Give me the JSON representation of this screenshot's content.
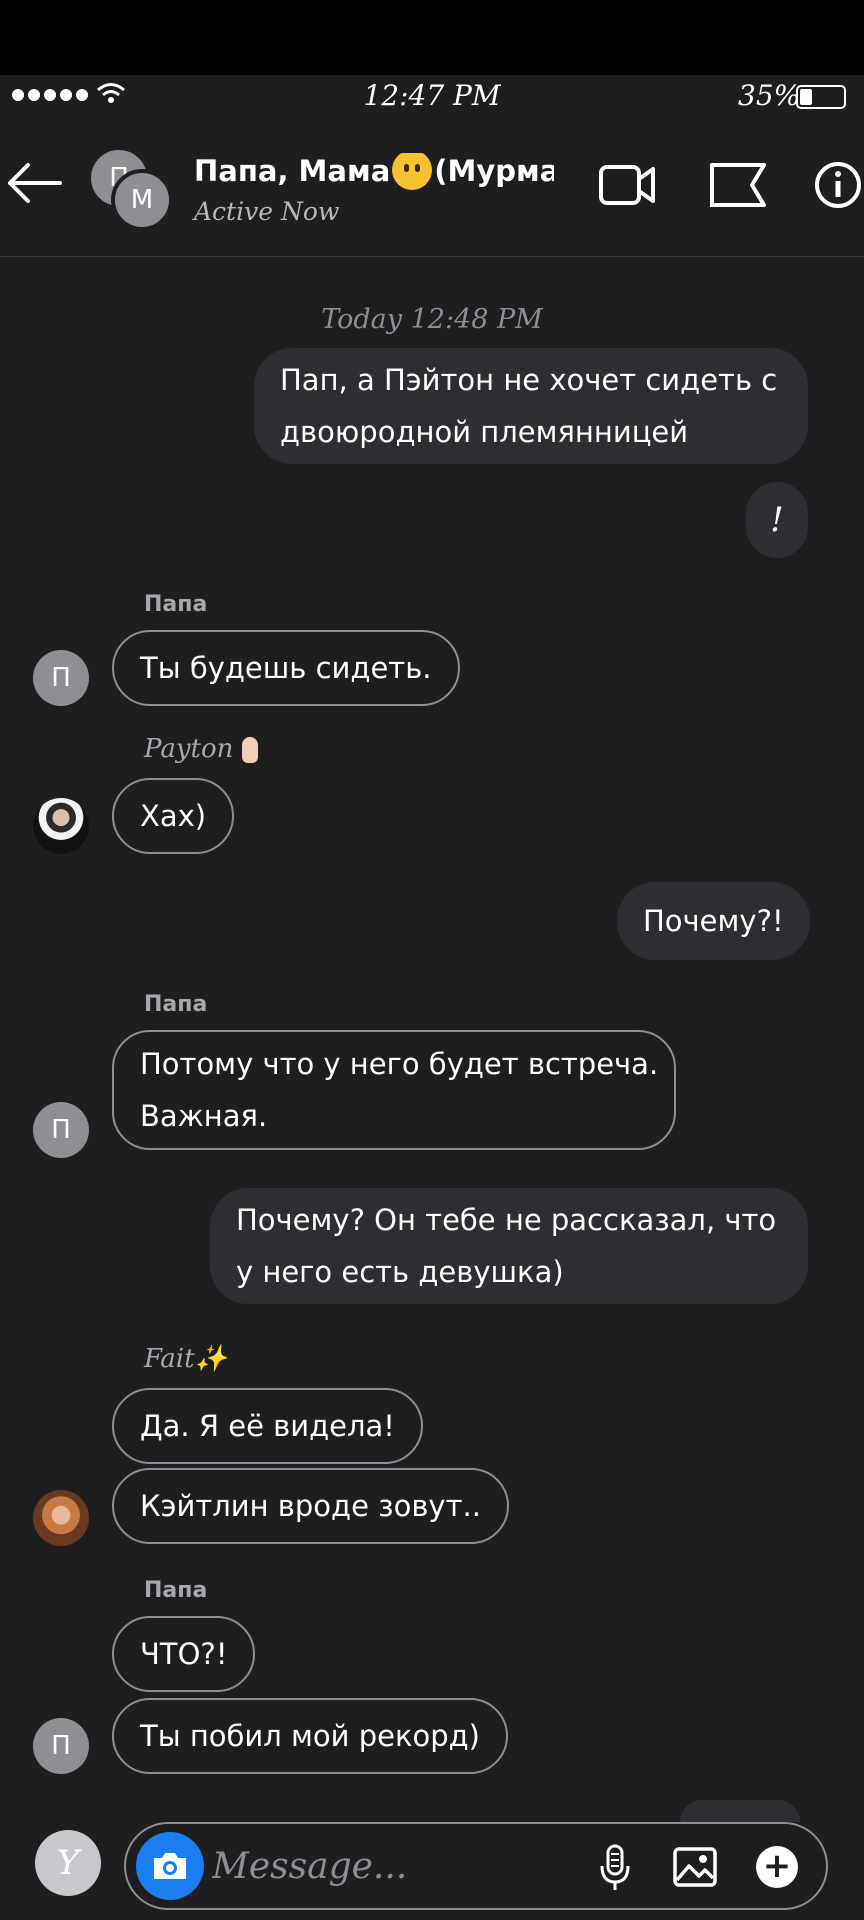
{
  "status_bar": {
    "time": "12:47 PM",
    "battery": "35%",
    "battery_level": 0.35
  },
  "header": {
    "title_part1": "Папа, Мама",
    "title_part2": "(Мурма...",
    "subtitle": "Active Now",
    "avatar_back_initial": "П",
    "avatar_front_initial": "М",
    "icons": [
      "back-arrow-icon",
      "video-call-icon",
      "flag-icon",
      "info-icon"
    ]
  },
  "chat": {
    "timestamp": "Today 12:48 PM",
    "messages": [
      {
        "from": "me",
        "line1": "Пап, а Пэйтон не хочет сидеть с",
        "line2": "двоюродной племянницей"
      },
      {
        "from": "me",
        "text": "!"
      },
      {
        "from": "Папа",
        "sender": "Папа",
        "text": "Ты будешь сидеть.",
        "avatar": "П"
      },
      {
        "from": "Payton",
        "sender": "Payton",
        "text": "Хах)"
      },
      {
        "from": "me",
        "text": "Почему?!"
      },
      {
        "from": "Папа",
        "sender": "Папа",
        "line1": "Потому что у него будет встреча.",
        "line2": "Важная.",
        "avatar": "П"
      },
      {
        "from": "me",
        "line1": "Почему? Он тебе не рассказал, что",
        "line2": "у него есть девушка)"
      },
      {
        "from": "Fait",
        "sender": "Fait",
        "text": "Да. Я её видела!"
      },
      {
        "from": "Fait",
        "text": "Кэйтлин вроде зовут.."
      },
      {
        "from": "Папа",
        "sender": "Папа",
        "text": "ЧТО?!"
      },
      {
        "from": "Папа",
        "text": "Ты побил мой рекорд)",
        "avatar": "П"
      }
    ]
  },
  "composer": {
    "avatar_initial": "Y",
    "placeholder": "Message...",
    "icons": [
      "camera-icon",
      "microphone-icon",
      "image-icon",
      "plus-icon"
    ]
  }
}
